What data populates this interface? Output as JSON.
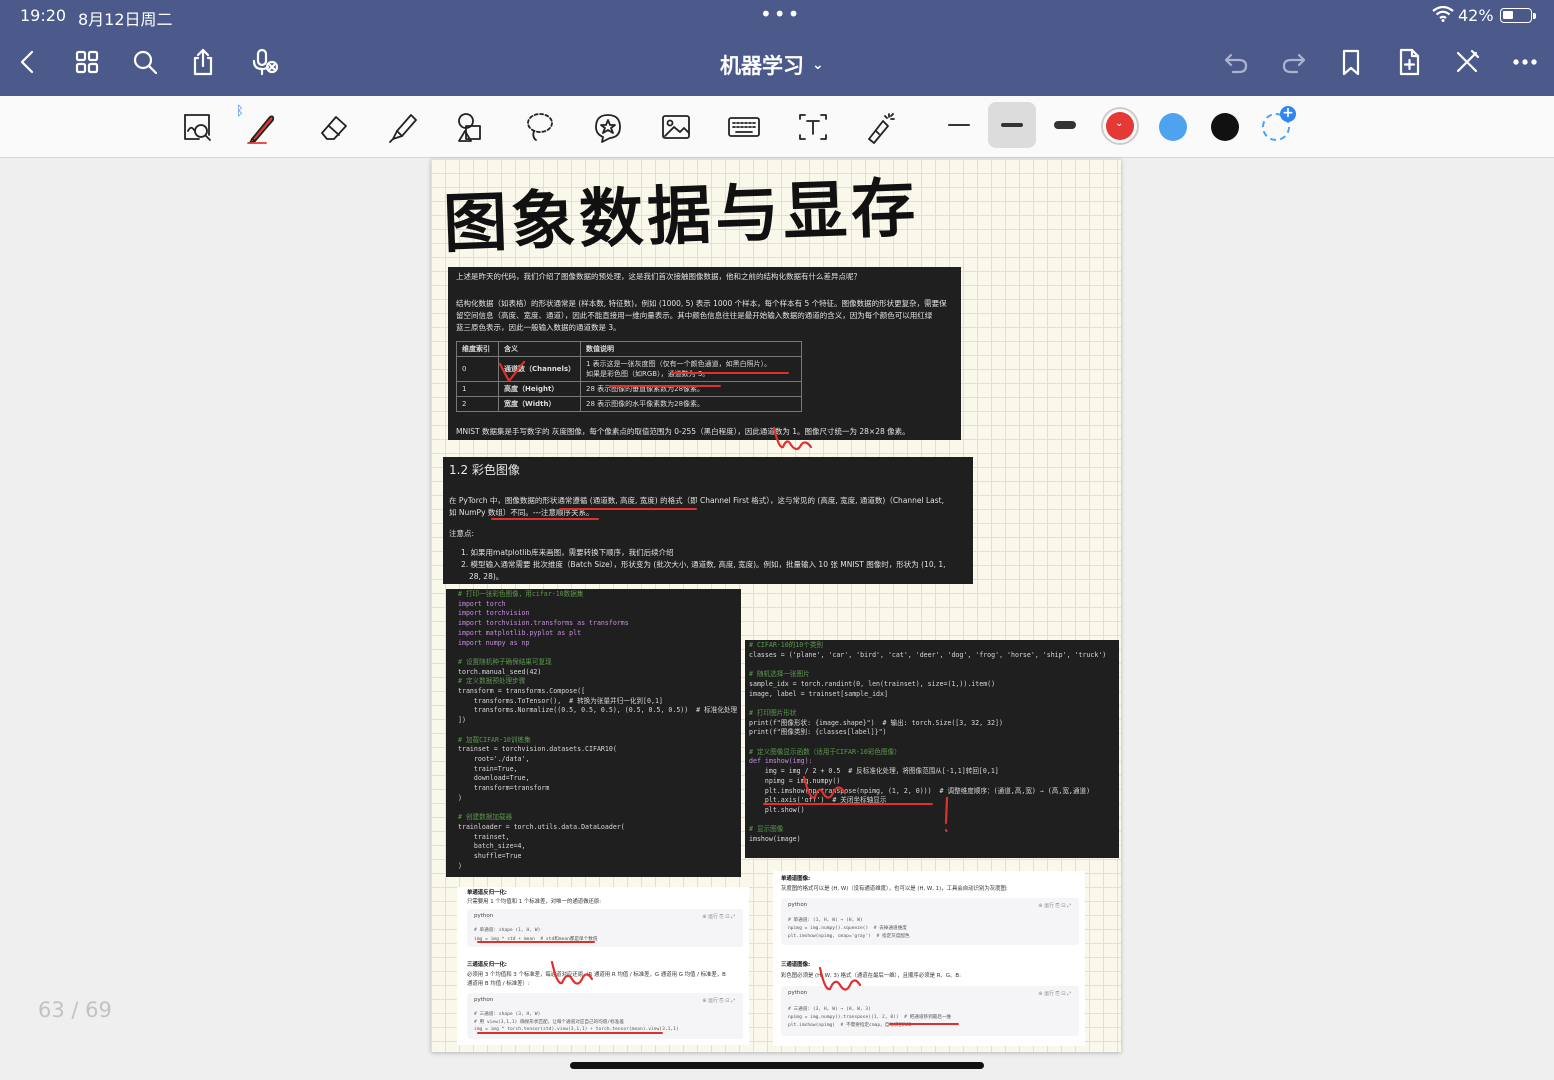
{
  "status": {
    "time": "19:20",
    "date": "8月12日周二",
    "battery": "42%",
    "battery_level": 0.42,
    "dots": "•••"
  },
  "header": {
    "title": "机器学习"
  },
  "colors": {
    "nav_bg": "#4b5a8a",
    "red": "#e53935",
    "blue": "#4da3f0",
    "black": "#111111"
  },
  "page": {
    "counter": "63 / 69",
    "title": "图象数据与显存",
    "card1": {
      "q": "上述是昨天的代码，我们介绍了图像数据的预处理，这是我们首次接触图像数据，他和之前的结构化数据有什么差异点呢？",
      "p1": "结构化数据（如表格）的形状通常是 (样本数, 特征数)，例如 (1000, 5) 表示 1000 个样本，每个样本有 5 个特征。图像数据的形状更复杂，需要保",
      "p2": "留空间信息（高度、宽度、通道），因此不能直接用一维向量表示。其中颜色信息往往是最开始输入数据的通道的含义，因为每个颜色可以用红绿",
      "p3": "蓝三原色表示，因此一般输入数据的通道数是 3。",
      "headers": [
        "维度索引",
        "含义",
        "数值说明"
      ],
      "rows": [
        {
          "idx": "0",
          "meaning": "通道数（Channels）",
          "desc1": "1 表示这是一张灰度图（仅有一个颜色通道，如黑白照片）。",
          "desc2": "如果是彩色图（如RGB），通道数为 3。"
        },
        {
          "idx": "1",
          "meaning": "高度（Height）",
          "desc1": "28 表示图像的垂直像素数为28像素。",
          "desc2": ""
        },
        {
          "idx": "2",
          "meaning": "宽度（Width）",
          "desc1": "28 表示图像的水平像素数为28像素。",
          "desc2": ""
        }
      ],
      "footer": "MNIST 数据集是手写数字的 灰度图像，每个像素点的取值范围为 0-255（黑白程度），因此通道数为 1。图像尺寸统一为 28×28 像素。"
    },
    "card2": {
      "heading": "1.2 彩色图像",
      "p1": "在 PyTorch 中，图像数据的形状通常遵循 (通道数, 高度, 宽度) 的格式（即 Channel First 格式），这与常见的 (高度, 宽度, 通道数)（Channel Last,",
      "p2": "如 NumPy 数组）不同。---注意顺序关系。",
      "note": "注意点:",
      "li1": "1. 如果用matplotlib库来画图，需要转换下顺序，我们后续介绍",
      "li2": "2. 模型输入通常需要 批次维度（Batch Size），形状变为 (批次大小, 通道数, 高度, 宽度)。例如，批量输入 10 张 MNIST 图像时，形状为 (10, 1,",
      "li3": "28, 28)。"
    },
    "code_left": [
      "# 打印一张彩色图像，用cifar-10数据集",
      "import torch",
      "import torchvision",
      "import torchvision.transforms as transforms",
      "import matplotlib.pyplot as plt",
      "import numpy as np",
      "",
      "# 设置随机种子确保结果可复现",
      "torch.manual_seed(42)",
      "# 定义数据预处理步骤",
      "transform = transforms.Compose([",
      "    transforms.ToTensor(),  # 转换为张量并归一化到[0,1]",
      "    transforms.Normalize((0.5, 0.5, 0.5), (0.5, 0.5, 0.5))  # 标准化处理",
      "])",
      "",
      "# 加载CIFAR-10训练集",
      "trainset = torchvision.datasets.CIFAR10(",
      "    root='./data',",
      "    train=True,",
      "    download=True,",
      "    transform=transform",
      ")",
      "",
      "# 创建数据加载器",
      "trainloader = torch.utils.data.DataLoader(",
      "    trainset,",
      "    batch_size=4,",
      "    shuffle=True",
      ")"
    ],
    "code_right": [
      "# CIFAR-10的10个类别",
      "classes = ('plane', 'car', 'bird', 'cat', 'deer', 'dog', 'frog', 'horse', 'ship', 'truck')",
      "",
      "# 随机选择一张图片",
      "sample_idx = torch.randint(0, len(trainset), size=(1,)).item()",
      "image, label = trainset[sample_idx]",
      "",
      "# 打印图片形状",
      "print(f\"图像形状: {image.shape}\")  # 输出: torch.Size([3, 32, 32])",
      "print(f\"图像类别: {classes[label]}\")",
      "",
      "# 定义图像显示函数（适用于CIFAR-10彩色图像）",
      "def imshow(img):",
      "    img = img / 2 + 0.5  # 反标准化处理，将图像范围从[-1,1]转回[0,1]",
      "    npimg = img.numpy()",
      "    plt.imshow(np.transpose(npimg, (1, 2, 0)))  # 调整维度顺序：(通道,高,宽) → (高,宽,通道)",
      "    plt.axis('off')  # 关闭坐标轴显示",
      "    plt.show()",
      "",
      "# 显示图像",
      "imshow(image)"
    ],
    "bl": {
      "s1_title": "单通道反归一化:",
      "s1_desc": "只需要用 1 个均值和 1 个标准差，对唯一的通道做还原:",
      "s1_lang": "python",
      "s1_ops": "⊕ 运行  ⎘  ⊡  ⤢",
      "s1_c1": "# 单通道: shape (1, H, W)",
      "s1_c2": "img = img * std + mean  # std和mean都是单个数值",
      "s2_title": "三通道反归一化:",
      "s2_desc": "必须用 3 个均值和 3 个标准差，每通道对应还原（R 通道用 R 均值 / 标准差，G 通道用 G 均值 / 标准差，B",
      "s2_desc2": "通道用 B 均值 / 标准差）:",
      "s2_lang": "python",
      "s2_ops": "⊕ 运行  ⎘  ⊡  ⤢",
      "s2_c1": "# 三通道: shape (3, H, W)",
      "s2_c2": "# 用 view(3,1,1) 确保形状匹配，让每个通道对应自己的均值/标准差",
      "s2_c3": "img = img * torch.tensor(std).view(3,1,1) + torch.tensor(mean).view(3,1,1)"
    },
    "br": {
      "s1_title": "单通道图像:",
      "s1_desc": "灰度图的格式可以是 (H, W)（没有通道维度），也可以是 (H, W, 1)，工具会自动识别为灰度图:",
      "s1_lang": "python",
      "s1_ops": "⊕ 运行  ⎘  ⊡  ⤢",
      "s1_c1": "# 单通道: (1, H, W) → (H, W)",
      "s1_c2": "npimg = img.numpy().squeeze()  # 去掉通道维度",
      "s1_c3": "plt.imshow(npimg, cmap='gray')  # 指定灰度配色",
      "s2_title": "三通道图像:",
      "s2_desc": "彩色图必须是 (H, W, 3) 格式（通道在最后一维），且顺序必须是 R、G、B:",
      "s2_lang": "python",
      "s2_ops": "⊕ 运行  ⎘  ⊡  ⤢",
      "s2_c1": "# 三通道: (3, H, W) → (H, W, 3)",
      "s2_c2": "npimg = img.numpy().transpose((1, 2, 0))  # 把通道移到最后一维",
      "s2_c3": "plt.imshow(npimg)  # 不需要指定cmap，自动识别RGB"
    }
  }
}
